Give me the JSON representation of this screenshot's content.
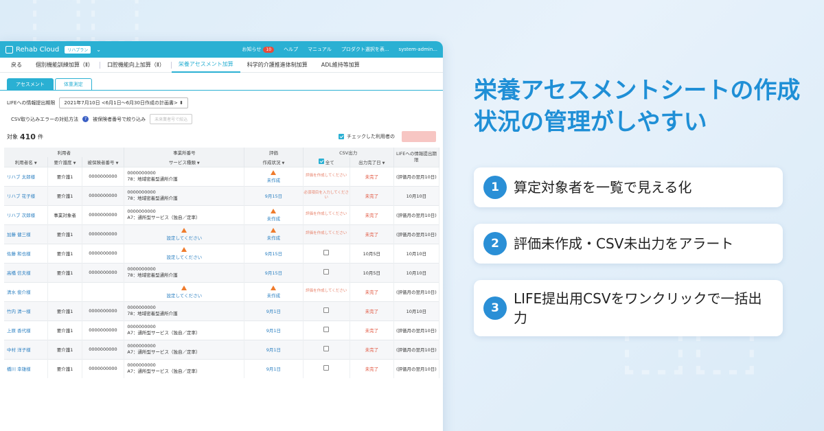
{
  "app": {
    "brand": "Rehab Cloud",
    "plan": "リハプラン",
    "topbar": {
      "notice": "お知らせ",
      "notice_count": "10",
      "help": "ヘルプ",
      "manual": "マニュアル",
      "product": "プロダクト選択を表...",
      "user": "system-admin..."
    },
    "tabs": [
      "戻る",
      "個別機能訓練加算（Ⅱ）",
      "口腔機能向上加算（Ⅱ）",
      "栄養アセスメント加算",
      "科学的介護推進体制加算",
      "ADL維持等加算"
    ],
    "subtabs": [
      "アセスメント",
      "体重測定"
    ],
    "filter": {
      "label": "LIFEへの情報提出期限",
      "value": "2021年7月10日 <6月1日〜6月30日作成の計画書>"
    },
    "csv": {
      "label": "CSV取り込みエラーの対処方法",
      "narrow": "被保険者番号で絞り込み",
      "placeholder": "未来業者号で絞込"
    },
    "count": {
      "label": "対象",
      "value": "410",
      "unit": "件"
    },
    "check_label": "チェックした利用者の",
    "headers": {
      "user": "利用者",
      "office": "事業所番号",
      "eval": "評価",
      "csv": "CSV出力",
      "life": "LIFEへの情報提出期限",
      "name": "利用者名",
      "care": "要介護度",
      "insured": "被保険者番号",
      "service": "サービス種類",
      "status": "作成状況",
      "all": "全て",
      "done": "出力完了日"
    },
    "rows": [
      {
        "name": "リハブ 太郎様",
        "care": "要介護1",
        "insured": "0000000000",
        "office": "0000000000",
        "service": "78：地域密着型通所介護",
        "status": "未作成",
        "csv": "評価を作成してください",
        "done": "未完了",
        "life": "(評価月の翌月10日)"
      },
      {
        "name": "リハブ 花子様",
        "care": "要介護1",
        "insured": "0000000000",
        "office": "0000000000",
        "service": "78：地域密着型通所介護",
        "status": "9月15日",
        "csv": "必須項目を入力してください",
        "done": "未完了",
        "life": "10月10日"
      },
      {
        "name": "リハブ 次郎様",
        "care": "事業対象者",
        "insured": "0000000000",
        "office": "0000000000",
        "service": "A7：通所型サービス（独自／定率）",
        "status": "未作成",
        "csv": "評価を作成してください",
        "done": "未完了",
        "life": "(評価月の翌月10日)"
      },
      {
        "name": "加藤 健三様",
        "care": "要介護1",
        "insured": "0000000000",
        "office": "",
        "service": "設定してください",
        "status": "未作成",
        "csv": "評価を作成してください",
        "done": "未完了",
        "life": "(評価月の翌月10日)"
      },
      {
        "name": "佐藤 和也様",
        "care": "要介護1",
        "insured": "0000000000",
        "office": "",
        "service": "設定してください",
        "status": "9月15日",
        "csv": "",
        "done": "10月5日",
        "life": "10月10日"
      },
      {
        "name": "高橋 信夫様",
        "care": "要介護1",
        "insured": "0000000000",
        "office": "0000000000",
        "service": "78：地域密着型通所介護",
        "status": "9月15日",
        "csv": "",
        "done": "10月5日",
        "life": "10月10日"
      },
      {
        "name": "清水 俊介様",
        "care": "",
        "insured": "",
        "office": "",
        "service": "設定してください",
        "status": "未作成",
        "csv": "評価を作成してください",
        "done": "未完了",
        "life": "(評価月の翌月10日)"
      },
      {
        "name": "竹内 清一様",
        "care": "要介護1",
        "insured": "0000000000",
        "office": "0000000000",
        "service": "78：地域密着型通所介護",
        "status": "9月1日",
        "csv": "",
        "done": "未完了",
        "life": "10月10日"
      },
      {
        "name": "上原 香代様",
        "care": "要介護1",
        "insured": "0000000000",
        "office": "0000000000",
        "service": "A7：通所型サービス（独自／定率）",
        "status": "9月1日",
        "csv": "",
        "done": "未完了",
        "life": "(評価月の翌月10日)"
      },
      {
        "name": "中村 洋子様",
        "care": "要介護1",
        "insured": "0000000000",
        "office": "0000000000",
        "service": "A7：通所型サービス（独自／定率）",
        "status": "9月1日",
        "csv": "",
        "done": "未完了",
        "life": "(評価月の翌月10日)"
      },
      {
        "name": "橋川 幸雄様",
        "care": "要介護1",
        "insured": "0000000000",
        "office": "0000000000",
        "service": "A7：通所型サービス（独自／定率）",
        "status": "9月1日",
        "csv": "",
        "done": "未完了",
        "life": "(評価月の翌月10日)"
      }
    ]
  },
  "headline": "栄養アセスメントシートの作成状況の管理がしやすい",
  "features": [
    {
      "num": "1",
      "text": "算定対象者を一覧で見える化"
    },
    {
      "num": "2",
      "text": "評価未作成・CSV未出力をアラート"
    },
    {
      "num": "3",
      "text": "LIFE提出用CSVをワンクリックで一括出力"
    }
  ],
  "colors": {
    "accent": "#2ab0d3",
    "headline": "#1f8fd6",
    "alert": "#ef7b2c"
  }
}
